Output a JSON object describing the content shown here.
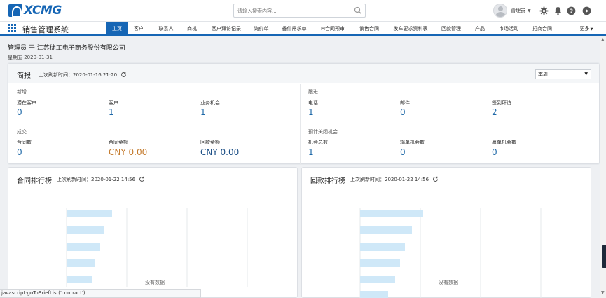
{
  "header": {
    "logo_text": "XCMG",
    "search_placeholder": "请输入搜索内容...",
    "user_name": "管理员",
    "icons": [
      "search-icon",
      "gear-icon",
      "bell-icon",
      "help-icon",
      "play-icon"
    ]
  },
  "nav": {
    "app_name": "销售管理系统",
    "items": [
      "主页",
      "客户",
      "联系人",
      "商机",
      "客户拜访记录",
      "询价单",
      "备件需求单",
      "M合同预审",
      "销售合同",
      "发车要求资料表",
      "回款管理",
      "产品",
      "市场活动",
      "招商合同"
    ],
    "more_label": "更多",
    "active_index": 0
  },
  "page": {
    "title_line": "管理员 于 江苏徐工电子商务股份有限公司",
    "date_line": "星期五 2020-01-31"
  },
  "brief": {
    "title": "简报",
    "refresh_text": "上次刷新时间：2020-01-16 21:20",
    "period_value": "本周",
    "sections": {
      "new": {
        "label": "新增",
        "metrics": [
          {
            "label": "潜在客户",
            "value": "0"
          },
          {
            "label": "客户",
            "value": "1"
          },
          {
            "label": "业务机会",
            "value": "1"
          }
        ]
      },
      "followup": {
        "label": "跟进",
        "metrics": [
          {
            "label": "电话",
            "value": "1"
          },
          {
            "label": "邮件",
            "value": "0"
          },
          {
            "label": "签到拜访",
            "value": "2"
          }
        ]
      },
      "deal": {
        "label": "成交",
        "metrics": [
          {
            "label": "合同数",
            "value": "0"
          },
          {
            "label": "合同金额",
            "value": "CNY 0.00"
          },
          {
            "label": "回款金额",
            "value": "CNY 0.00"
          }
        ]
      },
      "closing": {
        "label": "预计关闭机会",
        "metrics": [
          {
            "label": "机会总数",
            "value": "1"
          },
          {
            "label": "输单机会数",
            "value": "0"
          },
          {
            "label": "赢单机会数",
            "value": "0"
          }
        ]
      }
    }
  },
  "contract_rank": {
    "title": "合同排行榜",
    "refresh_text": "上次刷新时间：2020-01-22 14:56",
    "no_data": "没有数据"
  },
  "payment_rank": {
    "title": "回款排行榜",
    "refresh_text": "上次刷新时间：2020-01-22 14:56",
    "no_data": "没有数据"
  },
  "status_bar": {
    "text": "javascript:goToBriefList('contract')"
  },
  "colors": {
    "brand": "#1666b5",
    "metric_value": "#1f69a8",
    "amount_orange": "#c47a2c",
    "placeholder_bar": "#cfe8f8"
  }
}
